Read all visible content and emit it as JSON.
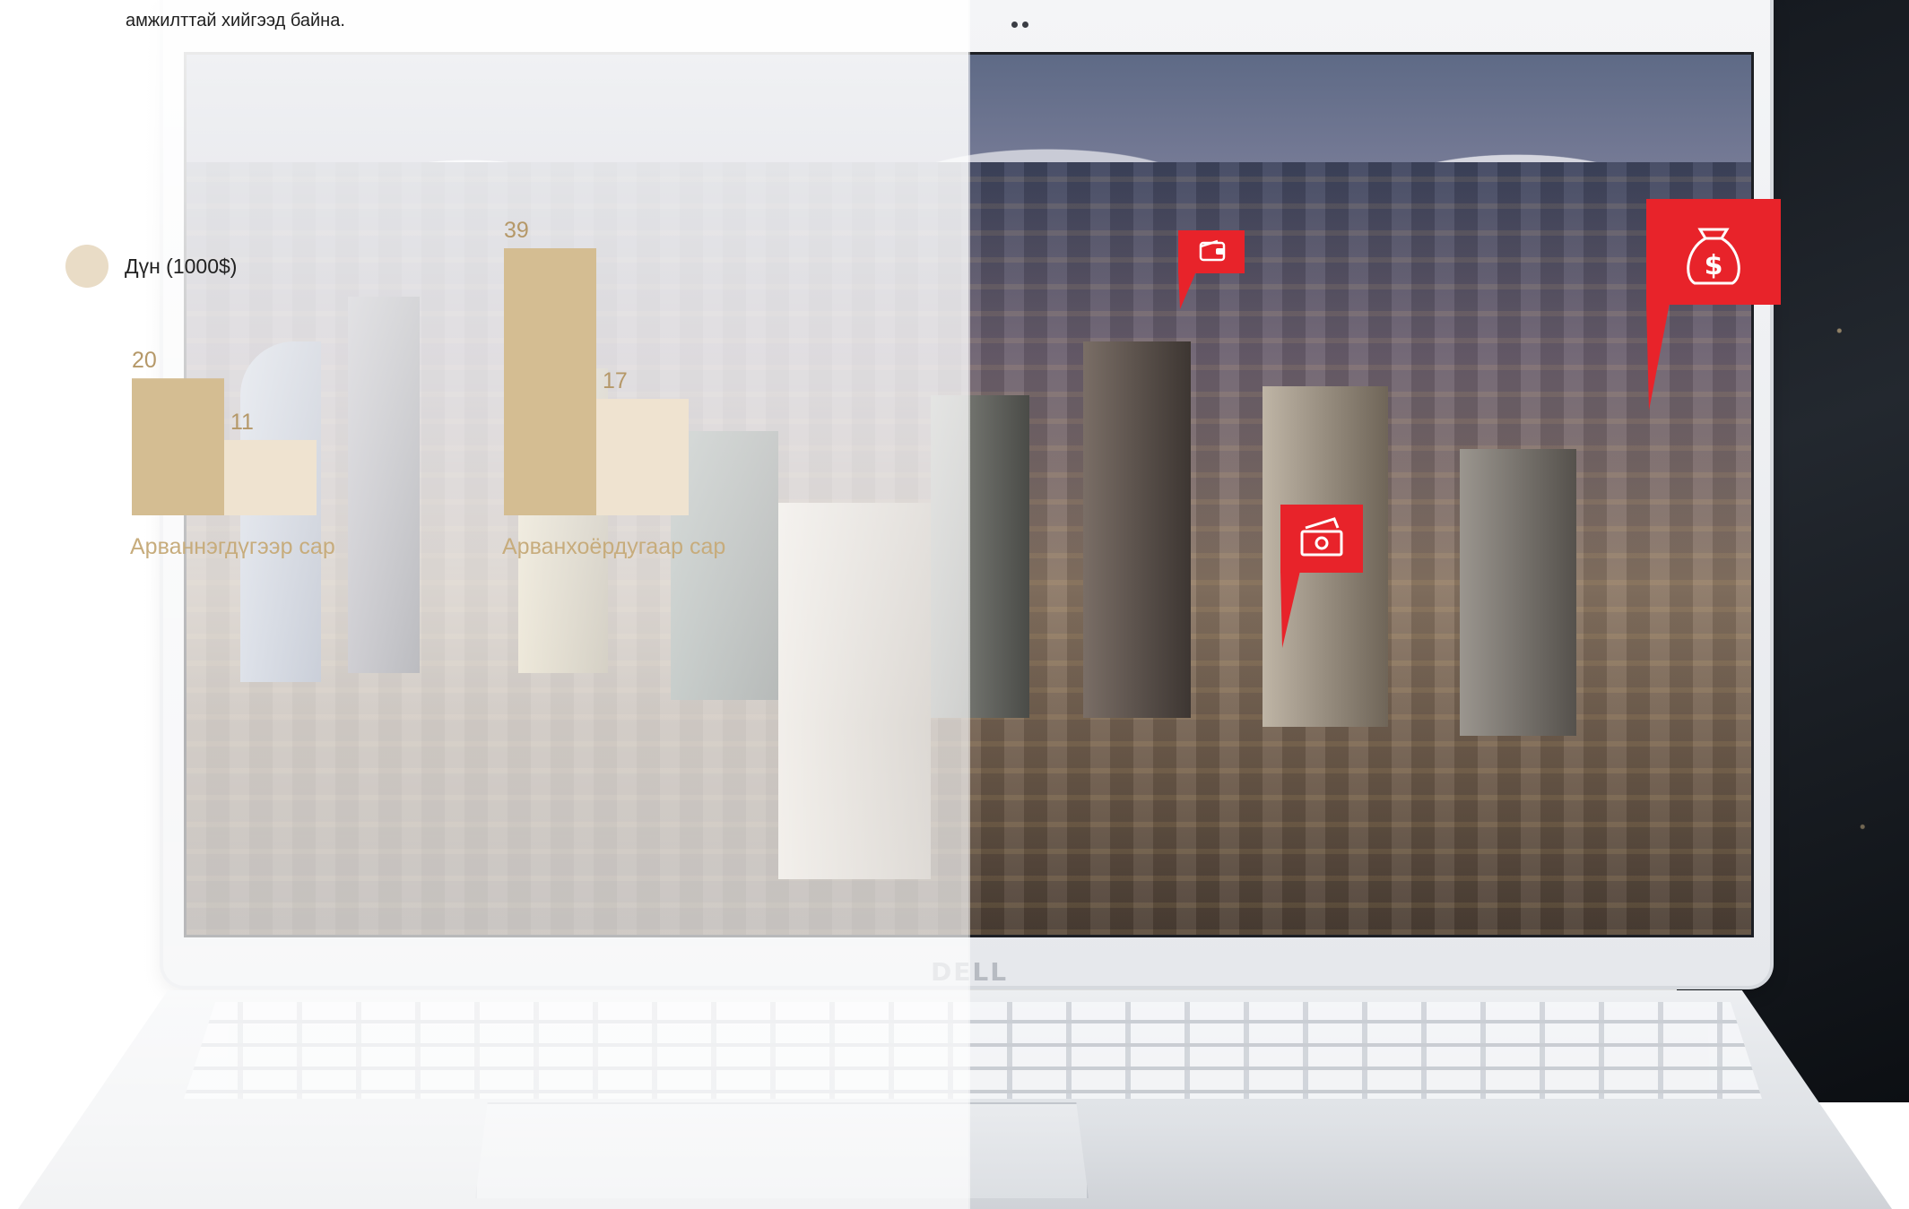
{
  "page": {
    "intro_text": "амжилттай хийгээд байна."
  },
  "colors": {
    "series_1": "#d4bd92",
    "series_2": "#efe3d0",
    "marker_red": "#e8232a",
    "label_gold": "#c7ac7c"
  },
  "laptop": {
    "brand": "DELL"
  },
  "icons": {
    "wallet": "wallet-icon",
    "money_bag": "money-bag-icon",
    "cash": "cash-icon"
  },
  "chart_data": {
    "type": "bar",
    "title": "",
    "xlabel": "",
    "ylabel": "",
    "categories": [
      "Арваннэгдүгээр сар",
      "Арванхоёрдугаар сар"
    ],
    "series": [
      {
        "name": "Дүн (1000$)",
        "values": [
          20,
          39
        ]
      },
      {
        "values": [
          11,
          17
        ]
      }
    ],
    "ylim": [
      0,
      39
    ],
    "legend": {
      "position": "top-left",
      "entries": [
        "Дүн (1000$)"
      ]
    },
    "grid": false
  }
}
